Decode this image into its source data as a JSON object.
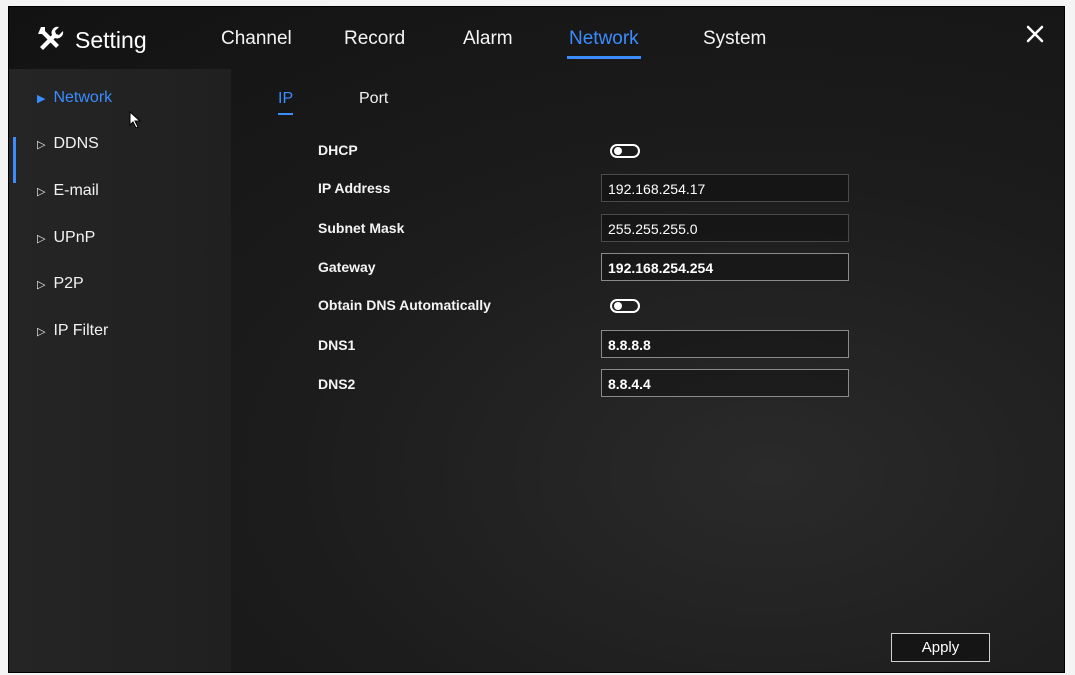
{
  "header": {
    "title": "Setting",
    "tabs": [
      {
        "label": "Channel"
      },
      {
        "label": "Record"
      },
      {
        "label": "Alarm"
      },
      {
        "label": "Network",
        "active": true
      },
      {
        "label": "System"
      }
    ]
  },
  "sidebar": {
    "items": [
      {
        "label": "Network",
        "active": true
      },
      {
        "label": "DDNS"
      },
      {
        "label": "E-mail"
      },
      {
        "label": "UPnP"
      },
      {
        "label": "P2P"
      },
      {
        "label": "IP Filter"
      }
    ]
  },
  "subtabs": [
    {
      "label": "IP",
      "active": true
    },
    {
      "label": "Port"
    }
  ],
  "form": {
    "dhcp": {
      "label": "DHCP",
      "enabled": false
    },
    "ip_address": {
      "label": "IP Address",
      "value": "192.168.254.17"
    },
    "subnet_mask": {
      "label": "Subnet Mask",
      "value": "255.255.255.0"
    },
    "gateway": {
      "label": "Gateway",
      "value": "192.168.254.254"
    },
    "obtain_dns": {
      "label": "Obtain DNS Automatically",
      "enabled": false
    },
    "dns1": {
      "label": "DNS1",
      "value": "8.8.8.8"
    },
    "dns2": {
      "label": "DNS2",
      "value": "8.8.4.4"
    }
  },
  "footer": {
    "apply_label": "Apply"
  },
  "colors": {
    "accent": "#3a8cff",
    "background": "#1a1a1a",
    "text": "#f2f2f2"
  },
  "icons": {
    "title": "tools-icon",
    "close": "close-icon",
    "toggle": "toggle-switch-icon",
    "sidebar_arrow": "triangle-right-icon"
  }
}
